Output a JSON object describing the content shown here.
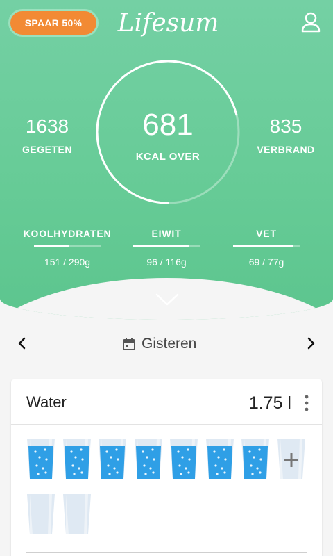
{
  "header": {
    "sale_badge": "SPAAR 50%",
    "logo": "Lifesum",
    "profile_icon": "profile-icon"
  },
  "summary": {
    "eaten_value": "1638",
    "eaten_label": "GEGETEN",
    "kcal_left_value": "681",
    "kcal_left_label": "KCAL OVER",
    "burned_value": "835",
    "burned_label": "VERBRAND",
    "ring_progress": 0.71
  },
  "macros": [
    {
      "name": "KOOLHYDRATEN",
      "amount": "151 / 290g",
      "progress": 0.52
    },
    {
      "name": "EIWIT",
      "amount": "96 / 116g",
      "progress": 0.83
    },
    {
      "name": "VET",
      "amount": "69 / 77g",
      "progress": 0.9
    }
  ],
  "date_nav": {
    "label": "Gisteren",
    "prev_icon": "chevron-left-icon",
    "next_icon": "chevron-right-icon",
    "calendar_icon": "calendar-icon"
  },
  "water": {
    "title": "Water",
    "amount": "1.75 l",
    "glasses_filled": 7,
    "glasses_total": 10
  },
  "colors": {
    "header_green": "#66cb96",
    "badge_orange": "#f28a34",
    "water_blue": "#2f9fe6"
  }
}
